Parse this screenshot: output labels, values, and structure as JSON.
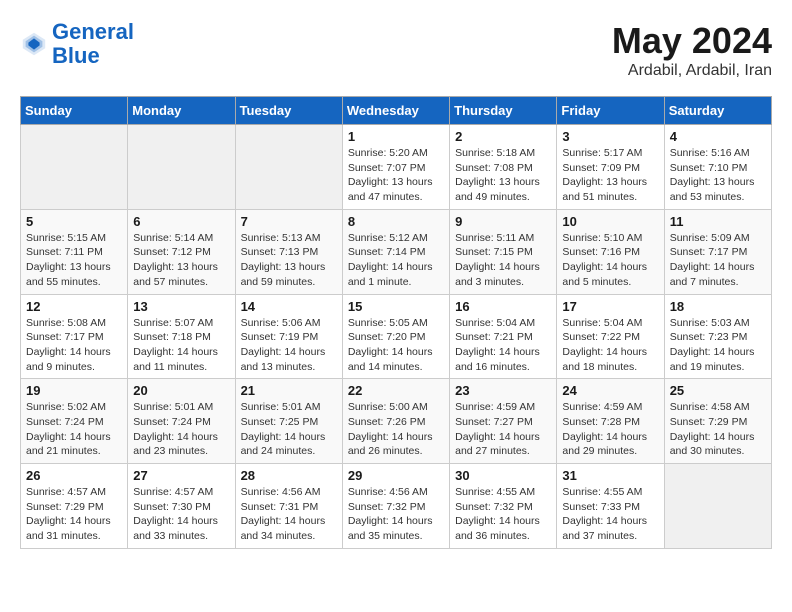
{
  "header": {
    "logo_line1": "General",
    "logo_line2": "Blue",
    "month_year": "May 2024",
    "location": "Ardabil, Ardabil, Iran"
  },
  "weekdays": [
    "Sunday",
    "Monday",
    "Tuesday",
    "Wednesday",
    "Thursday",
    "Friday",
    "Saturday"
  ],
  "weeks": [
    [
      {
        "day": "",
        "sunrise": "",
        "sunset": "",
        "daylight": ""
      },
      {
        "day": "",
        "sunrise": "",
        "sunset": "",
        "daylight": ""
      },
      {
        "day": "",
        "sunrise": "",
        "sunset": "",
        "daylight": ""
      },
      {
        "day": "1",
        "sunrise": "Sunrise: 5:20 AM",
        "sunset": "Sunset: 7:07 PM",
        "daylight": "Daylight: 13 hours and 47 minutes."
      },
      {
        "day": "2",
        "sunrise": "Sunrise: 5:18 AM",
        "sunset": "Sunset: 7:08 PM",
        "daylight": "Daylight: 13 hours and 49 minutes."
      },
      {
        "day": "3",
        "sunrise": "Sunrise: 5:17 AM",
        "sunset": "Sunset: 7:09 PM",
        "daylight": "Daylight: 13 hours and 51 minutes."
      },
      {
        "day": "4",
        "sunrise": "Sunrise: 5:16 AM",
        "sunset": "Sunset: 7:10 PM",
        "daylight": "Daylight: 13 hours and 53 minutes."
      }
    ],
    [
      {
        "day": "5",
        "sunrise": "Sunrise: 5:15 AM",
        "sunset": "Sunset: 7:11 PM",
        "daylight": "Daylight: 13 hours and 55 minutes."
      },
      {
        "day": "6",
        "sunrise": "Sunrise: 5:14 AM",
        "sunset": "Sunset: 7:12 PM",
        "daylight": "Daylight: 13 hours and 57 minutes."
      },
      {
        "day": "7",
        "sunrise": "Sunrise: 5:13 AM",
        "sunset": "Sunset: 7:13 PM",
        "daylight": "Daylight: 13 hours and 59 minutes."
      },
      {
        "day": "8",
        "sunrise": "Sunrise: 5:12 AM",
        "sunset": "Sunset: 7:14 PM",
        "daylight": "Daylight: 14 hours and 1 minute."
      },
      {
        "day": "9",
        "sunrise": "Sunrise: 5:11 AM",
        "sunset": "Sunset: 7:15 PM",
        "daylight": "Daylight: 14 hours and 3 minutes."
      },
      {
        "day": "10",
        "sunrise": "Sunrise: 5:10 AM",
        "sunset": "Sunset: 7:16 PM",
        "daylight": "Daylight: 14 hours and 5 minutes."
      },
      {
        "day": "11",
        "sunrise": "Sunrise: 5:09 AM",
        "sunset": "Sunset: 7:17 PM",
        "daylight": "Daylight: 14 hours and 7 minutes."
      }
    ],
    [
      {
        "day": "12",
        "sunrise": "Sunrise: 5:08 AM",
        "sunset": "Sunset: 7:17 PM",
        "daylight": "Daylight: 14 hours and 9 minutes."
      },
      {
        "day": "13",
        "sunrise": "Sunrise: 5:07 AM",
        "sunset": "Sunset: 7:18 PM",
        "daylight": "Daylight: 14 hours and 11 minutes."
      },
      {
        "day": "14",
        "sunrise": "Sunrise: 5:06 AM",
        "sunset": "Sunset: 7:19 PM",
        "daylight": "Daylight: 14 hours and 13 minutes."
      },
      {
        "day": "15",
        "sunrise": "Sunrise: 5:05 AM",
        "sunset": "Sunset: 7:20 PM",
        "daylight": "Daylight: 14 hours and 14 minutes."
      },
      {
        "day": "16",
        "sunrise": "Sunrise: 5:04 AM",
        "sunset": "Sunset: 7:21 PM",
        "daylight": "Daylight: 14 hours and 16 minutes."
      },
      {
        "day": "17",
        "sunrise": "Sunrise: 5:04 AM",
        "sunset": "Sunset: 7:22 PM",
        "daylight": "Daylight: 14 hours and 18 minutes."
      },
      {
        "day": "18",
        "sunrise": "Sunrise: 5:03 AM",
        "sunset": "Sunset: 7:23 PM",
        "daylight": "Daylight: 14 hours and 19 minutes."
      }
    ],
    [
      {
        "day": "19",
        "sunrise": "Sunrise: 5:02 AM",
        "sunset": "Sunset: 7:24 PM",
        "daylight": "Daylight: 14 hours and 21 minutes."
      },
      {
        "day": "20",
        "sunrise": "Sunrise: 5:01 AM",
        "sunset": "Sunset: 7:24 PM",
        "daylight": "Daylight: 14 hours and 23 minutes."
      },
      {
        "day": "21",
        "sunrise": "Sunrise: 5:01 AM",
        "sunset": "Sunset: 7:25 PM",
        "daylight": "Daylight: 14 hours and 24 minutes."
      },
      {
        "day": "22",
        "sunrise": "Sunrise: 5:00 AM",
        "sunset": "Sunset: 7:26 PM",
        "daylight": "Daylight: 14 hours and 26 minutes."
      },
      {
        "day": "23",
        "sunrise": "Sunrise: 4:59 AM",
        "sunset": "Sunset: 7:27 PM",
        "daylight": "Daylight: 14 hours and 27 minutes."
      },
      {
        "day": "24",
        "sunrise": "Sunrise: 4:59 AM",
        "sunset": "Sunset: 7:28 PM",
        "daylight": "Daylight: 14 hours and 29 minutes."
      },
      {
        "day": "25",
        "sunrise": "Sunrise: 4:58 AM",
        "sunset": "Sunset: 7:29 PM",
        "daylight": "Daylight: 14 hours and 30 minutes."
      }
    ],
    [
      {
        "day": "26",
        "sunrise": "Sunrise: 4:57 AM",
        "sunset": "Sunset: 7:29 PM",
        "daylight": "Daylight: 14 hours and 31 minutes."
      },
      {
        "day": "27",
        "sunrise": "Sunrise: 4:57 AM",
        "sunset": "Sunset: 7:30 PM",
        "daylight": "Daylight: 14 hours and 33 minutes."
      },
      {
        "day": "28",
        "sunrise": "Sunrise: 4:56 AM",
        "sunset": "Sunset: 7:31 PM",
        "daylight": "Daylight: 14 hours and 34 minutes."
      },
      {
        "day": "29",
        "sunrise": "Sunrise: 4:56 AM",
        "sunset": "Sunset: 7:32 PM",
        "daylight": "Daylight: 14 hours and 35 minutes."
      },
      {
        "day": "30",
        "sunrise": "Sunrise: 4:55 AM",
        "sunset": "Sunset: 7:32 PM",
        "daylight": "Daylight: 14 hours and 36 minutes."
      },
      {
        "day": "31",
        "sunrise": "Sunrise: 4:55 AM",
        "sunset": "Sunset: 7:33 PM",
        "daylight": "Daylight: 14 hours and 37 minutes."
      },
      {
        "day": "",
        "sunrise": "",
        "sunset": "",
        "daylight": ""
      }
    ]
  ]
}
